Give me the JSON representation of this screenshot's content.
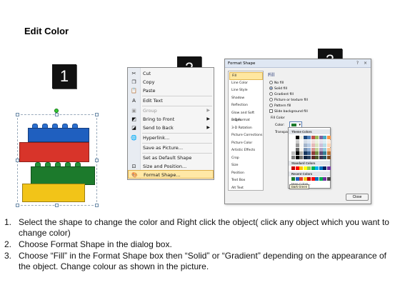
{
  "title": "Edit Color",
  "steps": [
    "1",
    "2",
    "3"
  ],
  "context_menu": {
    "items": [
      {
        "label": "Cut",
        "icon": "scissors-icon",
        "glyph": "✂",
        "disabled": false
      },
      {
        "label": "Copy",
        "icon": "copy-icon",
        "glyph": "❐",
        "disabled": false
      },
      {
        "label": "Paste",
        "icon": "paste-icon",
        "glyph": "📋",
        "disabled": false
      },
      {
        "label": "Edit Text",
        "icon": "edit-text-icon",
        "glyph": "A",
        "disabled": false
      },
      {
        "label": "Group",
        "icon": "group-icon",
        "glyph": "▣",
        "disabled": true,
        "submenu": true
      },
      {
        "label": "Bring to Front",
        "icon": "bring-front-icon",
        "glyph": "◩",
        "disabled": false,
        "submenu": true
      },
      {
        "label": "Send to Back",
        "icon": "send-back-icon",
        "glyph": "◪",
        "disabled": false,
        "submenu": true
      },
      {
        "label": "Hyperlink...",
        "icon": "hyperlink-icon",
        "glyph": "🌐",
        "disabled": false
      },
      {
        "label": "Save as Picture...",
        "icon": "",
        "glyph": "",
        "disabled": false
      },
      {
        "label": "Set as Default Shape",
        "icon": "",
        "glyph": "",
        "disabled": false
      },
      {
        "label": "Size and Position...",
        "icon": "size-position-icon",
        "glyph": "⊡",
        "disabled": false
      },
      {
        "label": "Format Shape...",
        "icon": "format-shape-icon",
        "glyph": "🎨",
        "disabled": false,
        "highlight": true
      }
    ]
  },
  "format_dialog": {
    "title": "Format Shape",
    "help": "?",
    "close_x": "×",
    "nav": [
      "Fill",
      "Line Color",
      "Line Style",
      "Shadow",
      "Reflection",
      "Glow and Soft Edges",
      "3-D Format",
      "3-D Rotation",
      "Picture Corrections",
      "Picture Color",
      "Artistic Effects",
      "Crop",
      "Size",
      "Position",
      "Text Box",
      "Alt Text"
    ],
    "active_nav": "Fill",
    "panel_heading": "Fill",
    "fill_options": [
      {
        "label": "No fill",
        "checked": false
      },
      {
        "label": "Solid fill",
        "checked": true
      },
      {
        "label": "Gradient fill",
        "checked": false
      },
      {
        "label": "Picture or texture fill",
        "checked": false
      },
      {
        "label": "Pattern fill",
        "checked": false
      }
    ],
    "slide_bg_label": "Slide background fill",
    "fill_color_label": "Fill Color",
    "color_label": "Color:",
    "transparency_label": "Transpa",
    "close_button": "Close",
    "selected_color": "#1c7a2c"
  },
  "palette": {
    "theme_heading": "Theme Colors",
    "standard_heading": "Standard Colors",
    "recent_heading": "Recent Colors",
    "more_colors": "More Colors...",
    "tooltip": "Dark Green",
    "theme_top": [
      "#ffffff",
      "#000000",
      "#eeece1",
      "#1f497d",
      "#4f81bd",
      "#c0504d",
      "#9bbb59",
      "#8064a2",
      "#4bacc6",
      "#f79646"
    ],
    "standard": [
      "#c00000",
      "#ff0000",
      "#ffc000",
      "#ffff00",
      "#92d050",
      "#00b050",
      "#00b0f0",
      "#0070c0",
      "#002060",
      "#7030a0"
    ],
    "recent": [
      "#1c7a2c",
      "#1f5fbf",
      "#e23b2a",
      "#f2c418",
      "#c00000",
      "#ff0000",
      "#0070c0",
      "#00b050",
      "#7030a0",
      "#404040"
    ]
  },
  "instructions": [
    {
      "num": "1.",
      "text": "Select the shape to change the color and Right click the object( click any object which you want to change color)"
    },
    {
      "num": "2.",
      "text": "Choose Format Shape in the dialog box."
    },
    {
      "num": "3.",
      "text": "Choose “Fill” in the Format Shape box then “Solid” or “Gradient” depending on the appearance of the object. Change colour as shown in the picture."
    }
  ],
  "colors": {
    "lego_blue": "#1f5fbf",
    "lego_red": "#d8342a",
    "lego_green": "#1c7a2c",
    "lego_yellow": "#f2c418",
    "menu_highlight": "#ffe8a6"
  }
}
